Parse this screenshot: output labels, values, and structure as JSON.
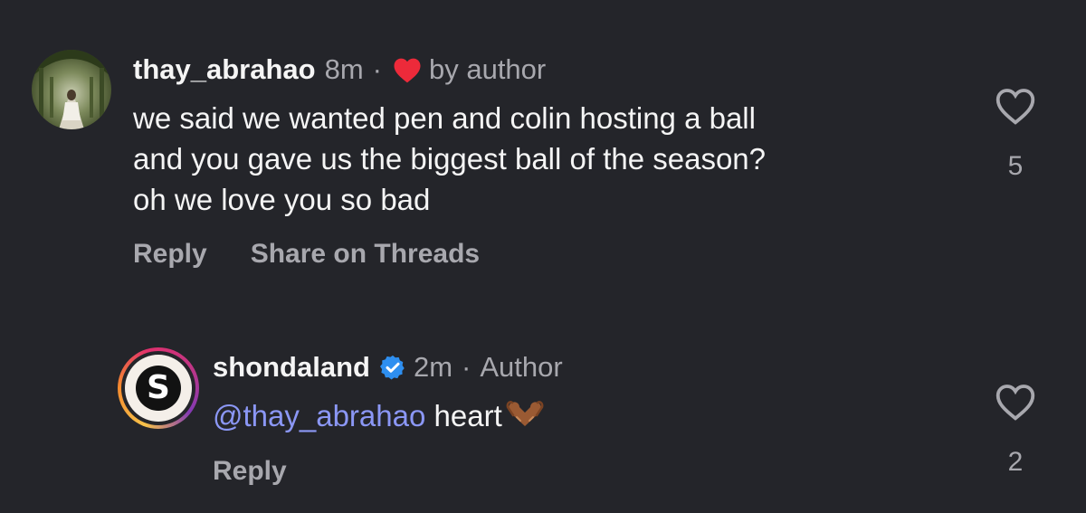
{
  "comments": [
    {
      "username": "thay_abrahao",
      "time": "8m",
      "separator": "·",
      "liked_label": "by author",
      "body_lines": [
        "we said we wanted pen and colin hosting a ball",
        "and you gave us the biggest ball of the season?",
        "oh we love you so bad"
      ],
      "actions": {
        "reply": "Reply",
        "share": "Share on Threads"
      },
      "likes": "5"
    },
    {
      "username": "shondaland",
      "verified": true,
      "time": "2m",
      "separator": "·",
      "role": "Author",
      "avatar_letter": "S",
      "mention": "@thay_abrahao",
      "text": "heart",
      "emoji": "heart-hands-emoji",
      "actions": {
        "reply": "Reply"
      },
      "likes": "2"
    }
  ],
  "colors": {
    "background": "#24252a",
    "text": "#f5f5f5",
    "muted": "#a8a8ae",
    "mention": "#8b97f5",
    "liked_heart": "#ed2a3a",
    "verified": "#2e8ff0"
  },
  "icons": {
    "liked": "heart-filled-icon",
    "verified": "verified-badge-icon",
    "like": "heart-outline-icon"
  }
}
